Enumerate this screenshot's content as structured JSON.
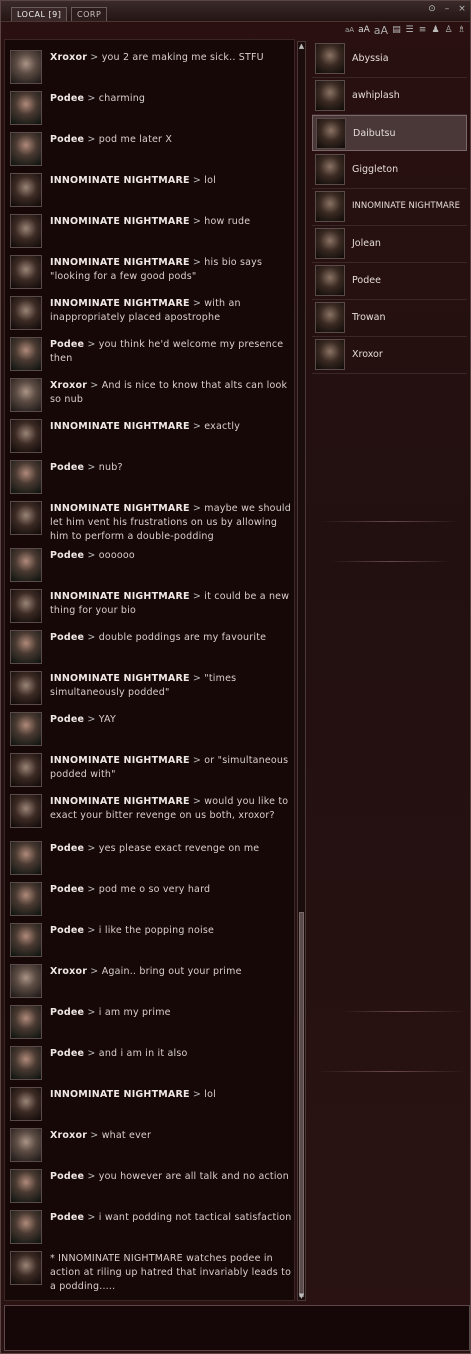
{
  "tabs": [
    {
      "label": "LOCAL [9]"
    },
    {
      "label": "CORP"
    }
  ],
  "toolbar": {
    "font_sizes": [
      "aA",
      "aA",
      "aA"
    ]
  },
  "members": [
    {
      "name": "Abyssia"
    },
    {
      "name": "awhiplash"
    },
    {
      "name": "Daibutsu",
      "selected": true
    },
    {
      "name": "Giggleton"
    },
    {
      "name": "INNOMINATE NIGHTMARE"
    },
    {
      "name": "Jolean"
    },
    {
      "name": "Podee"
    },
    {
      "name": "Trowan"
    },
    {
      "name": "Xroxor"
    }
  ],
  "messages": [
    {
      "speaker": "Xroxor",
      "text": "you 2 are making me sick.. STFU"
    },
    {
      "speaker": "Podee",
      "text": "charming"
    },
    {
      "speaker": "Podee",
      "text": "pod me later X"
    },
    {
      "speaker": "INNOMINATE NIGHTMARE",
      "text": "lol"
    },
    {
      "speaker": "INNOMINATE NIGHTMARE",
      "text": "how rude"
    },
    {
      "speaker": "INNOMINATE NIGHTMARE",
      "text": "his bio says \"looking for a few good pods\""
    },
    {
      "speaker": "INNOMINATE NIGHTMARE",
      "text": "with an inappropriately placed apostrophe"
    },
    {
      "speaker": "Podee",
      "text": "you think he'd welcome my presence then"
    },
    {
      "speaker": "Xroxor",
      "text": "And is nice to know that alts can look so nub"
    },
    {
      "speaker": "INNOMINATE NIGHTMARE",
      "text": "exactly"
    },
    {
      "speaker": "Podee",
      "text": "nub?"
    },
    {
      "speaker": "INNOMINATE NIGHTMARE",
      "text": "maybe we should let him vent his frustrations on us by allowing him to perform a double-podding"
    },
    {
      "speaker": "Podee",
      "text": "oooooo"
    },
    {
      "speaker": "INNOMINATE NIGHTMARE",
      "text": "it could be a new thing for your bio"
    },
    {
      "speaker": "Podee",
      "text": "double poddings are my favourite"
    },
    {
      "speaker": "INNOMINATE NIGHTMARE",
      "text": "\"times simultaneously podded\""
    },
    {
      "speaker": "Podee",
      "text": "YAY"
    },
    {
      "speaker": "INNOMINATE NIGHTMARE",
      "text": "or \"simultaneous podded with\""
    },
    {
      "speaker": "INNOMINATE NIGHTMARE",
      "text": "would you like to exact your bitter revenge on us both, xroxor?"
    },
    {
      "speaker": "Podee",
      "text": "yes please exact revenge on me"
    },
    {
      "speaker": "Podee",
      "text": "pod me o so very hard"
    },
    {
      "speaker": "Podee",
      "text": "i like the popping noise"
    },
    {
      "speaker": "Xroxor",
      "text": "Again.. bring out your prime"
    },
    {
      "speaker": "Podee",
      "text": "i am my prime"
    },
    {
      "speaker": "Podee",
      "text": "and i am in it also"
    },
    {
      "speaker": "INNOMINATE NIGHTMARE",
      "text": "lol"
    },
    {
      "speaker": "Xroxor",
      "text": "what ever"
    },
    {
      "speaker": "Podee",
      "text": "you however are all talk and no action"
    },
    {
      "speaker": "Podee",
      "text": "i want podding not tactical satisfaction"
    },
    {
      "speaker": "",
      "text": "* INNOMINATE NIGHTMARE watches podee in action at riling up hatred that invariably leads to a podding....."
    }
  ]
}
